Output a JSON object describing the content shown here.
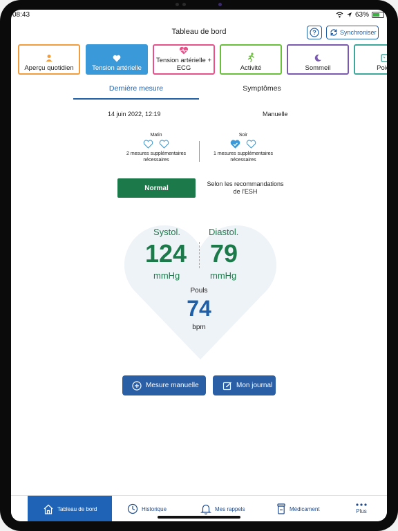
{
  "status_bar": {
    "time": "08:43",
    "battery": "63%",
    "battery_fraction": 0.63
  },
  "header": {
    "title": "Tableau de bord",
    "help_label": "?",
    "sync_label": "Synchroniser"
  },
  "categories": [
    {
      "label": "Aperçu quotidien",
      "icon": "person-icon",
      "color": "#f39c3c"
    },
    {
      "label": "Tension artérielle",
      "icon": "heart-icon",
      "color": "#3a9ad9",
      "active": true
    },
    {
      "label": "Tension artérielle + ECG",
      "icon": "heart-pulse-icon",
      "color": "#e8508a"
    },
    {
      "label": "Activité",
      "icon": "running-icon",
      "color": "#6abf3a"
    },
    {
      "label": "Sommeil",
      "icon": "moon-icon",
      "color": "#7a5ab0"
    },
    {
      "label": "Poids",
      "icon": "scale-icon",
      "color": "#3aa89a"
    }
  ],
  "tabs": {
    "active": "Dernière mesure",
    "other": "Symptômes"
  },
  "measurement": {
    "datetime": "14 juin 2022, 12:19",
    "mode": "Manuelle",
    "morning": {
      "label": "Matin",
      "info_line1": "2 mesures supplémentaires",
      "info_line2": "nécessaires"
    },
    "evening": {
      "label": "Soir",
      "info_line1": "1 mesures supplémentaires",
      "info_line2": "nécessaires"
    },
    "classification": "Normal",
    "reco_line1": "Selon les recommandations",
    "reco_line2": "de l'ESH",
    "systolic_label": "Systol.",
    "systolic_value": "124",
    "systolic_unit": "mmHg",
    "diastolic_label": "Diastol.",
    "diastolic_value": "79",
    "diastolic_unit": "mmHg",
    "pulse_label": "Pouls",
    "pulse_value": "74",
    "pulse_unit": "bpm"
  },
  "actions": {
    "manual": "Mesure manuelle",
    "journal": "Mon journal"
  },
  "bottom_nav": {
    "dashboard": "Tableau de bord",
    "history": "Historique",
    "reminders": "Mes rappels",
    "medication": "Médicament",
    "more": "Plus"
  },
  "colors": {
    "accent": "#1e5fa8",
    "green": "#1c7a4a",
    "nav_active": "#1f63b6"
  }
}
